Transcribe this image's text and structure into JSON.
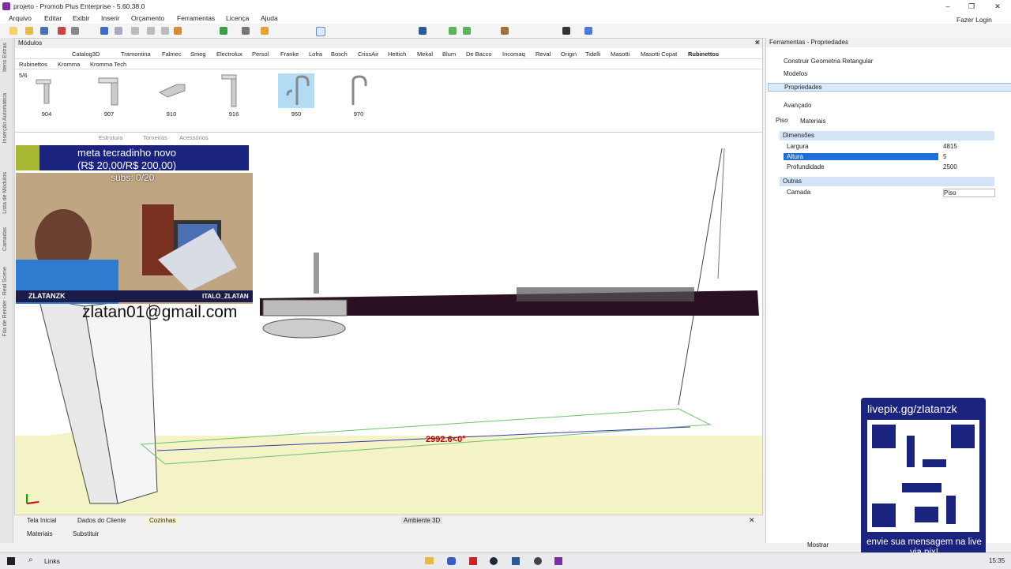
{
  "window": {
    "title": "projeto - Promob Plus Enterprise - 5.60.38.0",
    "login": "Fazer Login"
  },
  "menu": [
    "Arquivo",
    "Editar",
    "Exibir",
    "Inserir",
    "Orçamento",
    "Ferramentas",
    "Licença",
    "Ajuda"
  ],
  "modules": {
    "title": "Módulos",
    "brand_tabs": [
      "Catalog3D",
      "Tramontina",
      "Falmec",
      "Smeg",
      "Electrolux",
      "Persol",
      "Franke",
      "Lofra",
      "Bosch",
      "CrissAir",
      "Hettich",
      "Mekal",
      "Blum",
      "De Bacco",
      "Incomaq",
      "Reval",
      "Origin",
      "Tidelli",
      "Masotti",
      "Masotti Copat",
      "Rubinettos"
    ],
    "sub_tabs": [
      "Rubinettos",
      "Kromma",
      "Kromma Tech"
    ],
    "page_indicator": "5/6",
    "items": [
      "904",
      "907",
      "910",
      "916",
      "950",
      "970"
    ],
    "selected_item": "950"
  },
  "view": {
    "dimension_label": "2992.6<0°",
    "hidden_tabs": [
      "Estrutura",
      "Torneiras",
      "Acessórios"
    ]
  },
  "bottom_tabs": [
    "Tela Inicial",
    "Dados do Cliente",
    "Cozinhas",
    "Ambiente 3D"
  ],
  "bottom_tabs2": [
    "Materiais",
    "Substituir"
  ],
  "properties": {
    "panel_title": "Ferramentas - Propriedades",
    "tools": [
      "Construir Geometria Retangular",
      "Modelos",
      "Propriedades"
    ],
    "advanced_label": "Avançado",
    "tabs": [
      "Piso",
      "Materiais"
    ],
    "sections": [
      {
        "title": "Dimensões",
        "rows": [
          {
            "key": "Largura",
            "value": "4815"
          },
          {
            "key": "Altura",
            "value": "5"
          },
          {
            "key": "Profundidade",
            "value": "2500"
          }
        ]
      },
      {
        "title": "Outras",
        "rows": [
          {
            "key": "Camada",
            "value": "Piso"
          }
        ]
      }
    ],
    "selected_key": "Altura"
  },
  "overlay": {
    "meta_line1": "meta tecradinho novo",
    "meta_line2": "(R$ 20,00/R$ 200,00)",
    "subs": "subs: 0/20",
    "name_left": "ZLATANZK",
    "name_right": "ITALO_ZLATAN",
    "email": "zlatan01@gmail.com",
    "pix_url": "livepix.gg/zlatanzk",
    "pix_msg": "envie sua mensagem na live via pix!"
  },
  "status": {
    "show_label": "Mostrar"
  },
  "taskbar": {
    "search": "Links",
    "time": "15:35"
  },
  "colors": {
    "accent": "#1a237e",
    "selection": "#1e6fd9",
    "floor": "#f4f4c8"
  }
}
